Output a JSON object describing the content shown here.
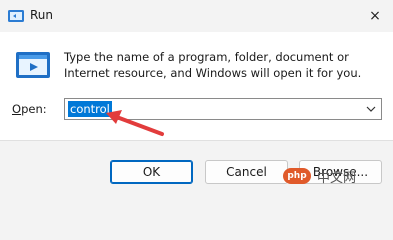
{
  "window": {
    "title": "Run",
    "close_icon": "×"
  },
  "dialog": {
    "description": "Type the name of a program, folder, document or Internet resource, and Windows will open it for you.",
    "open_label_prefix": "",
    "open_label_accel": "O",
    "open_label_rest": "pen:",
    "open_value": "control",
    "chevron_icon": "chevron-down"
  },
  "buttons": {
    "ok": "OK",
    "cancel": "Cancel",
    "browse": "Browse..."
  },
  "watermark": {
    "badge": "php",
    "text": "中文网"
  },
  "colors": {
    "selection": "#0078d7",
    "annotation_arrow": "#e23c3c",
    "ok_border": "#0067c0"
  }
}
